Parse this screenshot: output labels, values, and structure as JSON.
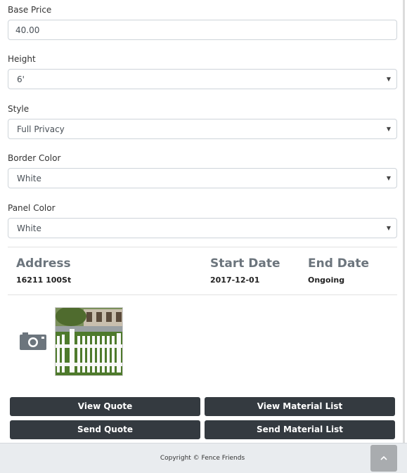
{
  "form": {
    "base_price": {
      "label": "Base Price",
      "value": "40.00"
    },
    "height": {
      "label": "Height",
      "value": "6'"
    },
    "style": {
      "label": "Style",
      "value": "Full Privacy"
    },
    "border_color": {
      "label": "Border Color",
      "value": "White"
    },
    "panel_color": {
      "label": "Panel Color",
      "value": "White"
    }
  },
  "job": {
    "address_label": "Address",
    "address_value": "16211 100St",
    "start_label": "Start Date",
    "start_value": "2017-12-01",
    "end_label": "End Date",
    "end_value": "Ongoing"
  },
  "media": {
    "camera_icon": "camera-icon",
    "photo_alt": "fence-photo"
  },
  "actions": {
    "view_quote": "View Quote",
    "view_material_list": "View Material List",
    "send_quote": "Send Quote",
    "send_material_list": "Send Material List"
  },
  "footer": {
    "copyright": "Copyright © Fence Friends",
    "top_icon": "chevron-up-icon"
  },
  "colors": {
    "button_bg": "#343a40",
    "footer_bg": "#e9ecef",
    "label_gray": "#6c757d"
  }
}
